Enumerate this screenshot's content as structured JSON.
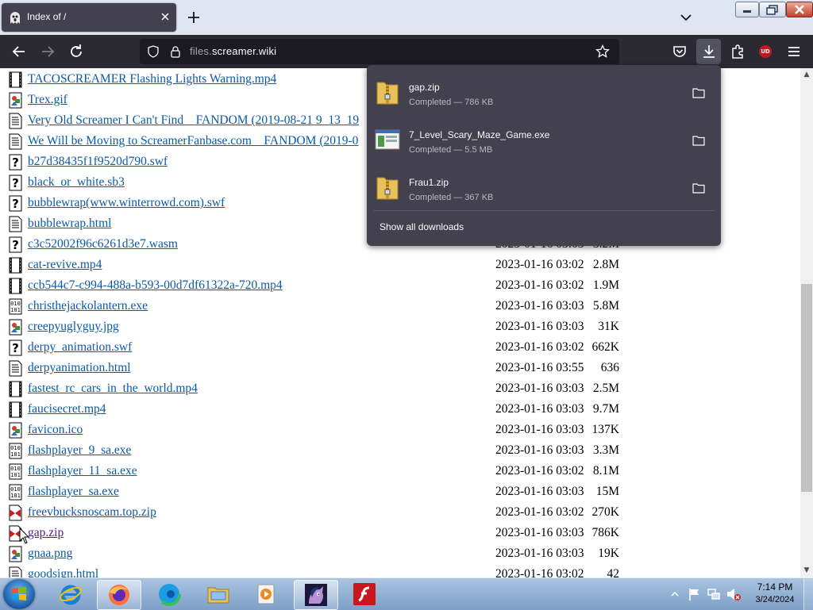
{
  "browser": {
    "tab_title": "Index of /",
    "url_host_dim": "files.",
    "url_host_main": "screamer.wiki",
    "ext_badge": "UD"
  },
  "files": [
    {
      "name": "TACOSCREAMER  Flashing  Lights  Warning.mp4",
      "icon": "video-file-icon",
      "date": "",
      "size": ""
    },
    {
      "name": "Trex.gif",
      "icon": "image-file-icon",
      "date": "",
      "size": ""
    },
    {
      "name": "Very Old Screamer I Can't Find _ FANDOM (2019-08-21 9_13_19",
      "icon": "text-file-icon",
      "date": "",
      "size": ""
    },
    {
      "name": "We Will be Moving to ScreamerFanbase.com _ FANDOM (2019-0",
      "icon": "text-file-icon",
      "date": "",
      "size": ""
    },
    {
      "name": "b27d38435f1f9520d790.swf",
      "icon": "unknown-file-icon",
      "date": "",
      "size": ""
    },
    {
      "name": "black_or_white.sb3",
      "icon": "unknown-file-icon",
      "date": "",
      "size": ""
    },
    {
      "name": "bubblewrap(www.winterrowd.com).swf",
      "icon": "unknown-file-icon",
      "date": "",
      "size": ""
    },
    {
      "name": "bubblewrap.html",
      "icon": "text-file-icon",
      "date": "",
      "size": ""
    },
    {
      "name": "c3c52002f96c6261d3e7.wasm",
      "icon": "unknown-file-icon",
      "date": "2023-01-16 03:03",
      "size": "3.2M"
    },
    {
      "name": "cat-revive.mp4",
      "icon": "video-file-icon",
      "date": "2023-01-16 03:02",
      "size": "2.8M"
    },
    {
      "name": "ccb544c7-c994-488a-b593-00d7df61322a-720.mp4",
      "icon": "video-file-icon",
      "date": "2023-01-16 03:02",
      "size": "1.9M"
    },
    {
      "name": "christhejackolantern.exe",
      "icon": "binary-file-icon",
      "date": "2023-01-16 03:03",
      "size": "5.8M"
    },
    {
      "name": "creepyuglyguy.jpg",
      "icon": "image-file-icon",
      "date": "2023-01-16 03:03",
      "size": "31K"
    },
    {
      "name": "derpy_animation.swf",
      "icon": "unknown-file-icon",
      "date": "2023-01-16 03:02",
      "size": "662K"
    },
    {
      "name": "derpyanimation.html",
      "icon": "text-file-icon",
      "date": "2023-01-16 03:55",
      "size": "636"
    },
    {
      "name": "fastest_rc_cars_in_the_world.mp4",
      "icon": "video-file-icon",
      "date": "2023-01-16 03:03",
      "size": "2.5M"
    },
    {
      "name": "faucisecret.mp4",
      "icon": "video-file-icon",
      "date": "2023-01-16 03:03",
      "size": "9.7M"
    },
    {
      "name": "favicon.ico",
      "icon": "image-file-icon",
      "date": "2023-01-16 03:03",
      "size": "137K"
    },
    {
      "name": "flashplayer_9_sa.exe",
      "icon": "binary-file-icon",
      "date": "2023-01-16 03:03",
      "size": "3.3M"
    },
    {
      "name": "flashplayer_11_sa.exe",
      "icon": "binary-file-icon",
      "date": "2023-01-16 03:02",
      "size": "8.1M"
    },
    {
      "name": "flashplayer_sa.exe",
      "icon": "binary-file-icon",
      "date": "2023-01-16 03:03",
      "size": "15M"
    },
    {
      "name": "freevbucksnoscam.top.zip",
      "icon": "compressed-file-icon",
      "date": "2023-01-16 03:02",
      "size": "270K"
    },
    {
      "name": "gap.zip",
      "icon": "compressed-file-icon",
      "date": "2023-01-16 03:03",
      "size": "786K",
      "visited": true
    },
    {
      "name": "gnaa.png",
      "icon": "image-file-icon",
      "date": "2023-01-16 03:03",
      "size": "19K"
    },
    {
      "name": "goodsign.html",
      "icon": "text-file-icon",
      "date": "2023-01-16 03:02",
      "size": "42"
    }
  ],
  "downloads": {
    "items": [
      {
        "name": "gap.zip",
        "status": "Completed — 786 KB",
        "icon": "zip-folder-icon"
      },
      {
        "name": "7_Level_Scary_Maze_Game.exe",
        "status": "Completed — 5.5 MB",
        "icon": "exe-window-icon"
      },
      {
        "name": "Frau1.zip",
        "status": "Completed — 367 KB",
        "icon": "zip-folder-icon"
      }
    ],
    "show_all": "Show all downloads"
  },
  "taskbar": {
    "apps": [
      "internet-explorer-icon",
      "firefox-icon",
      "edge-icon",
      "file-explorer-icon",
      "media-player-icon",
      "pony-app-icon",
      "flash-player-icon"
    ],
    "time": "7:14 PM",
    "date": "3/24/2024"
  }
}
